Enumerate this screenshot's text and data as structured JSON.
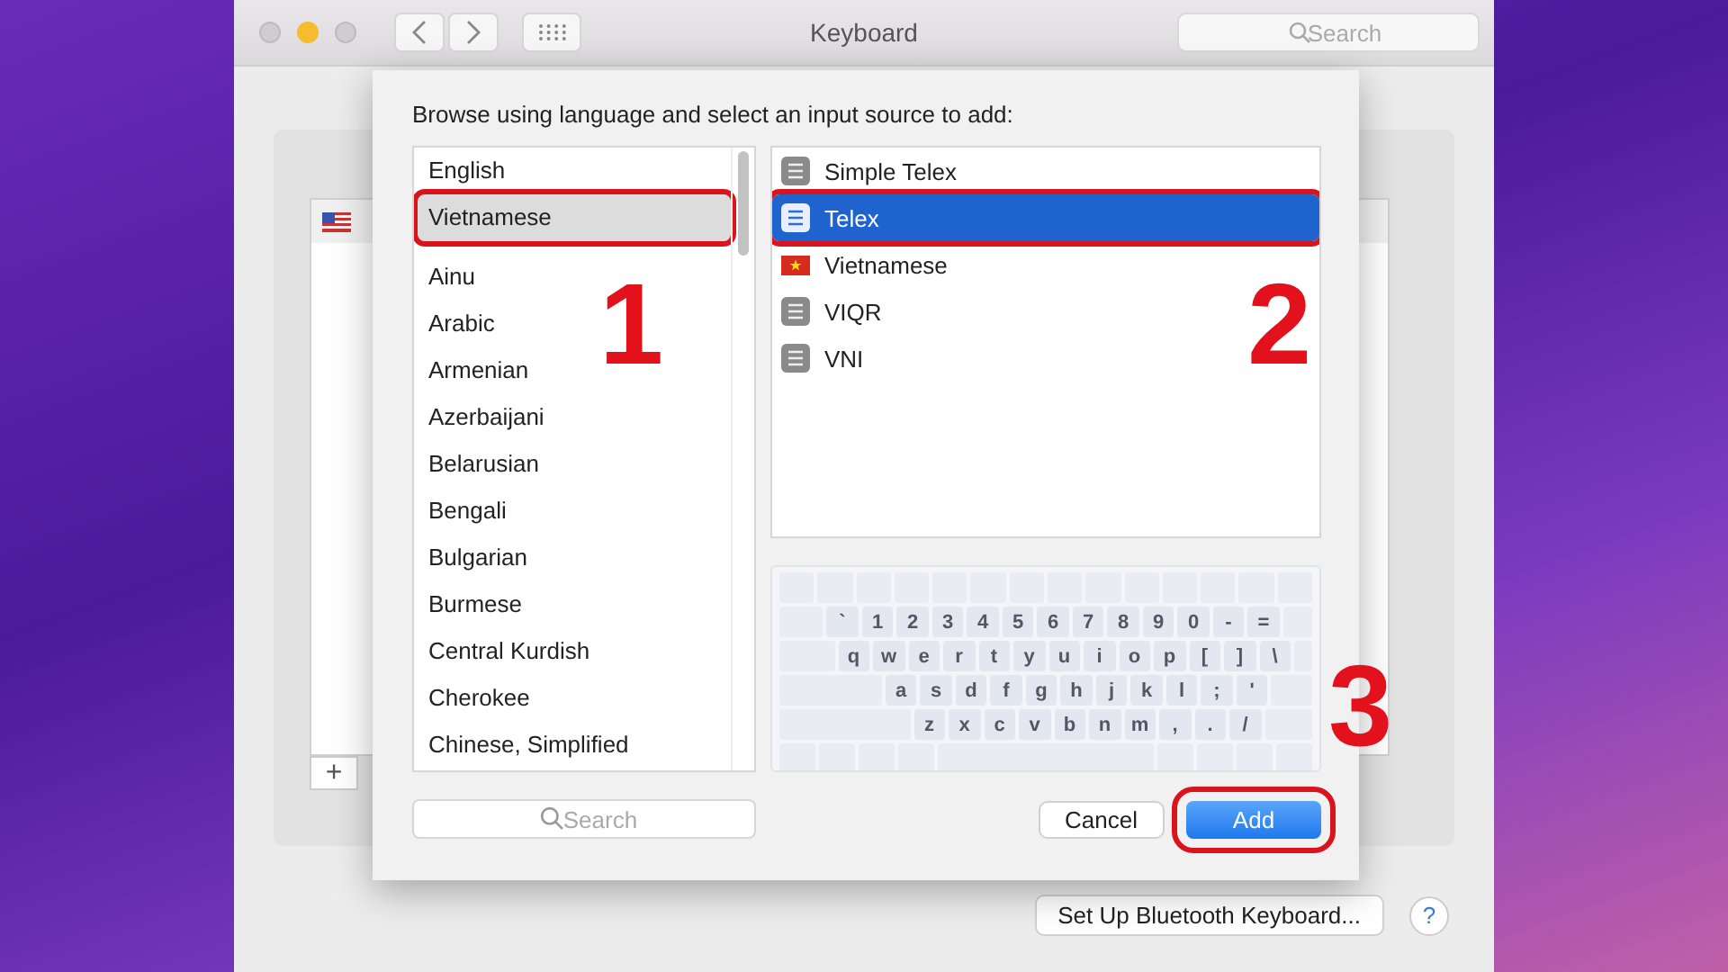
{
  "window": {
    "title": "Keyboard",
    "search": {
      "placeholder": "Search"
    }
  },
  "sheet": {
    "prompt": "Browse using language and select an input source to add:",
    "languages": [
      {
        "label": "English",
        "selected": false,
        "highlighted": false
      },
      {
        "label": "Vietnamese",
        "selected": true,
        "highlighted": true
      },
      {
        "label": "Ainu",
        "selected": false,
        "highlighted": false
      },
      {
        "label": "Arabic",
        "selected": false,
        "highlighted": false
      },
      {
        "label": "Armenian",
        "selected": false,
        "highlighted": false
      },
      {
        "label": "Azerbaijani",
        "selected": false,
        "highlighted": false
      },
      {
        "label": "Belarusian",
        "selected": false,
        "highlighted": false
      },
      {
        "label": "Bengali",
        "selected": false,
        "highlighted": false
      },
      {
        "label": "Bulgarian",
        "selected": false,
        "highlighted": false
      },
      {
        "label": "Burmese",
        "selected": false,
        "highlighted": false
      },
      {
        "label": "Central Kurdish",
        "selected": false,
        "highlighted": false
      },
      {
        "label": "Cherokee",
        "selected": false,
        "highlighted": false
      },
      {
        "label": "Chinese, Simplified",
        "selected": false,
        "highlighted": false
      }
    ],
    "sources": [
      {
        "label": "Simple Telex",
        "kind": "badge",
        "selected": false,
        "highlighted": false
      },
      {
        "label": "Telex",
        "kind": "badge",
        "selected": true,
        "highlighted": true
      },
      {
        "label": "Vietnamese",
        "kind": "flag",
        "selected": false,
        "highlighted": false
      },
      {
        "label": "VIQR",
        "kind": "badge",
        "selected": false,
        "highlighted": false
      },
      {
        "label": "VNI",
        "kind": "badge",
        "selected": false,
        "highlighted": false
      }
    ],
    "keyboard_rows": [
      [
        "`",
        "1",
        "2",
        "3",
        "4",
        "5",
        "6",
        "7",
        "8",
        "9",
        "0",
        "-",
        "="
      ],
      [
        "q",
        "w",
        "e",
        "r",
        "t",
        "y",
        "u",
        "i",
        "o",
        "p",
        "[",
        "]",
        "\\"
      ],
      [
        "a",
        "s",
        "d",
        "f",
        "g",
        "h",
        "j",
        "k",
        "l",
        ";",
        "'"
      ],
      [
        "z",
        "x",
        "c",
        "v",
        "b",
        "n",
        "m",
        ",",
        ".",
        "/"
      ]
    ],
    "search": {
      "placeholder": "Search"
    },
    "cancel_button": "Cancel",
    "add_button": {
      "label": "Add",
      "highlighted": true
    }
  },
  "add_source_button": "+",
  "bluetooth_button": "Set Up Bluetooth Keyboard...",
  "help_button": "?",
  "annotations": [
    "1",
    "2",
    "3"
  ]
}
